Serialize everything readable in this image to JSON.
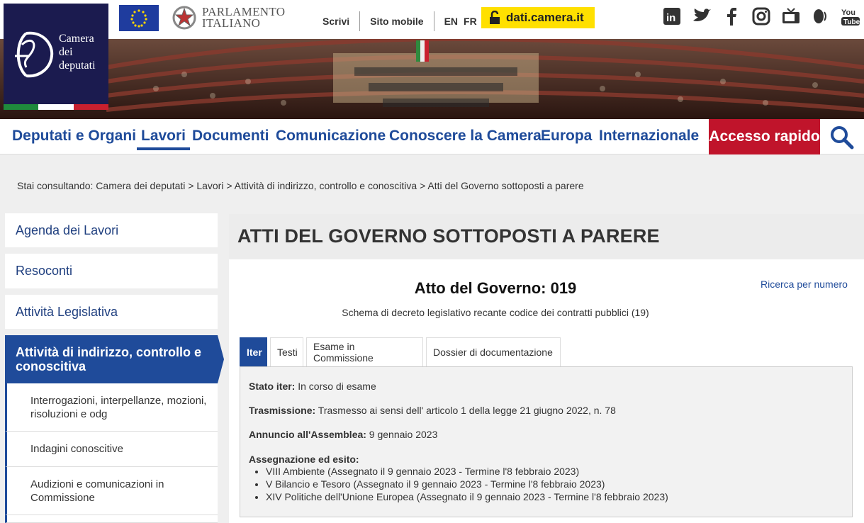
{
  "header": {
    "logo_lines": [
      "Camera",
      "dei",
      "deputati"
    ],
    "parliament_lines": [
      "PARLAMENTO",
      "ITALIANO"
    ],
    "toplinks": [
      "Scrivi",
      "Sito mobile"
    ],
    "languages": [
      "EN",
      "FR"
    ],
    "dati_label": "dati.camera.it",
    "social": [
      "linkedin-icon",
      "twitter-icon",
      "facebook-icon",
      "instagram-icon",
      "tv-icon",
      "radio-icon",
      "youtube-icon"
    ]
  },
  "nav": {
    "items": [
      "Deputati e Organi",
      "Lavori",
      "Documenti",
      "Comunicazione",
      "Conoscere la Camera",
      "Europa",
      "Internazionale"
    ],
    "active": "Lavori",
    "accesso": "Accesso rapido"
  },
  "breadcrumb": "Stai consultando: Camera dei deputati > Lavori > Attività di indirizzo, controllo e conoscitiva > Atti del Governo sottoposti a parere",
  "sidebar": {
    "items": [
      "Agenda dei Lavori",
      "Resoconti",
      "Attività Legislativa"
    ],
    "active": "Attività di indirizzo, controllo e conoscitiva",
    "subitems": [
      "Interrogazioni, interpellanze, mozioni, risoluzioni e odg",
      "Indagini conoscitive",
      "Audizioni e comunicazioni in Commissione"
    ]
  },
  "content": {
    "page_title": "ATTI DEL GOVERNO SOTTOPOSTI A PARERE",
    "atto_title": "Atto del Governo: 019",
    "atto_subtitle": "Schema di decreto legislativo recante codice dei contratti pubblici (19)",
    "ricerca": "Ricerca per numero",
    "tabs": [
      "Iter",
      "Testi",
      "Esame in Commissione",
      "Dossier di documentazione"
    ],
    "stato_label": "Stato iter:",
    "stato_value": " In corso di esame",
    "trasm_label": "Trasmissione:",
    "trasm_value": " Trasmesso ai sensi dell' articolo 1 della legge 21 giugno 2022, n. 78",
    "annuncio_label": "Annuncio all'Assemblea:",
    "annuncio_value": " 9 gennaio 2023",
    "assegn_label": "Assegnazione ed esito:",
    "assegn_items": [
      "VIII Ambiente (Assegnato il 9 gennaio 2023 - Termine l'8 febbraio 2023)",
      "V Bilancio e Tesoro (Assegnato il 9 gennaio 2023 - Termine l'8 febbraio 2023)",
      "XIV Politiche dell'Unione Europea (Assegnato il 9 gennaio 2023 - Termine l'8 febbraio 2023)"
    ]
  },
  "colors": {
    "brand_blue": "#1f4b9a",
    "accent_red": "#c0142b",
    "dati_yellow": "#ffe000",
    "logo_bg": "#1b1b4f"
  }
}
